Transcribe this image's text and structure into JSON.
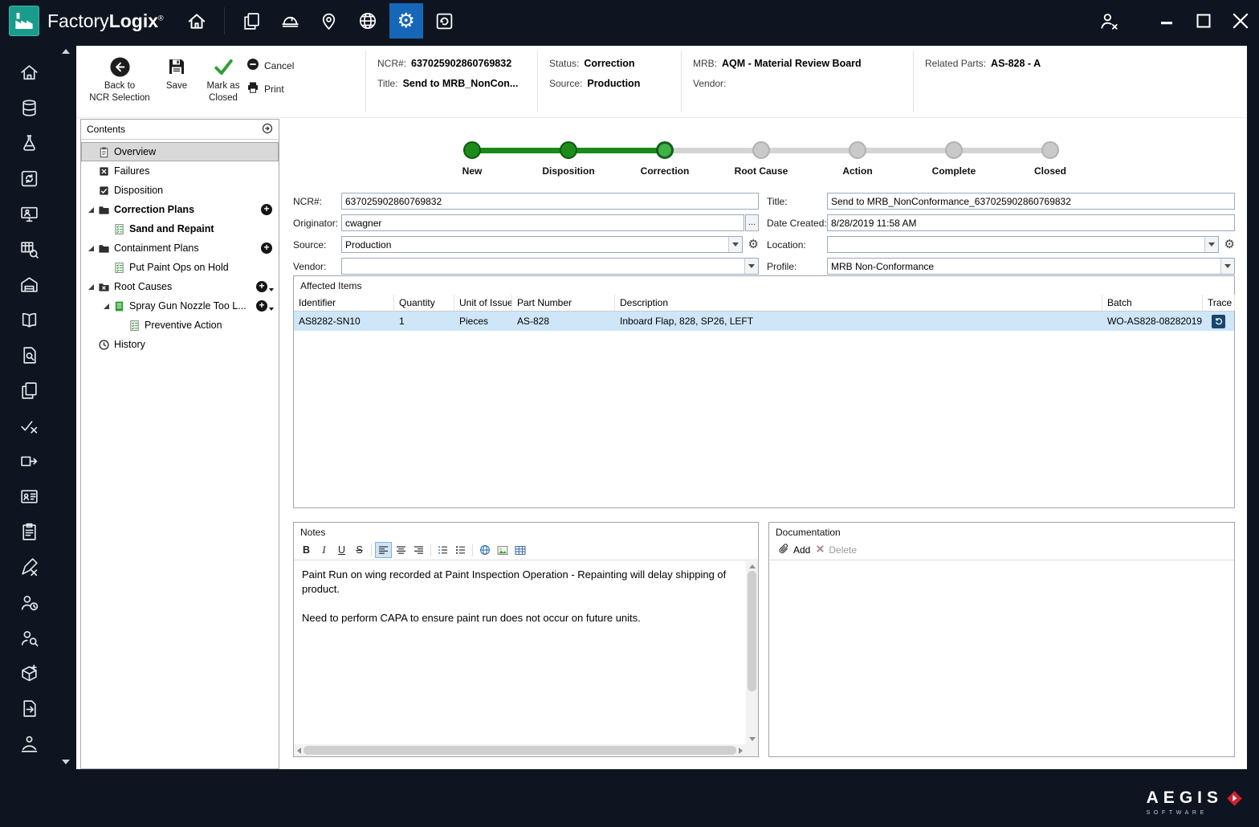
{
  "colors": {
    "chrome": "#0e1520",
    "accent_blue": "#1767b8",
    "brand_teal": "#1a9c8c",
    "step_done_green": "#188a18",
    "step_current_green": "#41b246",
    "row_selected_blue": "#cfe6f8",
    "aegis_red": "#cf2030"
  },
  "titlebar": {
    "brand_part1": "Factory",
    "brand_part2": "Logix",
    "registered_mark": "®",
    "icons": [
      "home",
      "copy-documents",
      "construction-helmet",
      "location-pin",
      "globe",
      "settings-gear",
      "history-refresh"
    ],
    "active_icon": "settings-gear",
    "window_icons": [
      "user-logout",
      "minimize",
      "maximize",
      "close"
    ]
  },
  "left_rail": {
    "icons": [
      "home",
      "production-data",
      "quality-check",
      "process-sync",
      "workstation",
      "schedule-search",
      "warehouse",
      "documentation-book",
      "document-search",
      "copy-pages",
      "verify-tasks",
      "material-transfer",
      "id-card",
      "work-instructions",
      "design-edit",
      "user-time",
      "user-search",
      "package-add",
      "document-export",
      "operator-handover",
      "data-grid"
    ]
  },
  "action_bar": {
    "back_label_line1": "Back to",
    "back_label_line2": "NCR Selection",
    "save_label": "Save",
    "mark_closed_line1": "Mark as",
    "mark_closed_line2": "Closed",
    "cancel_label": "Cancel",
    "print_label": "Print"
  },
  "summary": {
    "ncr_label": "NCR#:",
    "ncr_value": "637025902860769832",
    "title_label": "Title:",
    "title_value": "Send to MRB_NonCon...",
    "status_label": "Status:",
    "status_value": "Correction",
    "source_label": "Source:",
    "source_value": "Production",
    "mrb_label": "MRB:",
    "mrb_value": "AQM - Material Review Board",
    "vendor_label": "Vendor:",
    "vendor_value": "",
    "related_label": "Related Parts:",
    "related_value": "AS-828 - A"
  },
  "contents": {
    "header": "Contents",
    "items": [
      {
        "label": "Overview",
        "icon": "clipboard",
        "level": 0,
        "selected": true
      },
      {
        "label": "Failures",
        "icon": "failure-box",
        "level": 0
      },
      {
        "label": "Disposition",
        "icon": "check-box",
        "level": 0
      },
      {
        "label": "Correction Plans",
        "icon": "folder",
        "level": 0,
        "bold": true,
        "expander": true,
        "add": true
      },
      {
        "label": "Sand and Repaint",
        "icon": "plan-checklist",
        "level": 1,
        "bold": true
      },
      {
        "label": "Containment Plans",
        "icon": "folder",
        "level": 0,
        "expander": true,
        "add": true
      },
      {
        "label": "Put Paint Ops on Hold",
        "icon": "plan-checklist",
        "level": 1
      },
      {
        "label": "Root Causes",
        "icon": "folder-x",
        "level": 0,
        "expander": true,
        "add": true,
        "add_menu": true
      },
      {
        "label": "Spray Gun Nozzle Too L...",
        "icon": "cause-doc",
        "level": 1,
        "expander": true,
        "add": true,
        "add_menu": true
      },
      {
        "label": "Preventive Action",
        "icon": "plan-checklist",
        "level": 2
      },
      {
        "label": "History",
        "icon": "history-clock",
        "level": 0
      }
    ]
  },
  "stepper": [
    {
      "label": "New",
      "state": "done"
    },
    {
      "label": "Disposition",
      "state": "done"
    },
    {
      "label": "Correction",
      "state": "current"
    },
    {
      "label": "Root Cause",
      "state": "pending"
    },
    {
      "label": "Action",
      "state": "pending"
    },
    {
      "label": "Complete",
      "state": "pending"
    },
    {
      "label": "Closed",
      "state": "pending"
    }
  ],
  "form": {
    "ncr_label": "NCR#:",
    "ncr_value": "637025902860769832",
    "title_label": "Title:",
    "title_value": "Send to MRB_NonConformance_637025902860769832",
    "originator_label": "Originator:",
    "originator_value": "cwagner",
    "browse_button": "…",
    "date_created_label": "Date Created:",
    "date_created_value": "8/28/2019 11:58 AM",
    "source_label": "Source:",
    "source_value": "Production",
    "location_label": "Location:",
    "location_value": "",
    "vendor_label": "Vendor:",
    "vendor_value": "",
    "profile_label": "Profile:",
    "profile_value": "MRB Non-Conformance"
  },
  "affected_items": {
    "title": "Affected Items",
    "columns": [
      "Identifier",
      "Quantity",
      "Unit of Issue",
      "Part Number",
      "Description",
      "Batch",
      "Trace"
    ],
    "rows": [
      {
        "cells": [
          "AS8282-SN10",
          "1",
          "Pieces",
          "AS-828",
          "Inboard Flap, 828, SP26, LEFT",
          "WO-AS828-08282019"
        ],
        "trace_icon": "trace-history",
        "selected": true
      }
    ]
  },
  "notes": {
    "title": "Notes",
    "toolbar": {
      "bold": "B",
      "italic": "I",
      "underline": "U",
      "strike": "S"
    },
    "toolbar_icons": [
      "align-left",
      "align-center",
      "align-right",
      "numbered-list",
      "bullet-list",
      "hyperlink-globe",
      "insert-image",
      "insert-table"
    ],
    "paragraphs": [
      "Paint Run on wing recorded at Paint Inspection Operation - Repainting will delay shipping of product.",
      "Need to perform CAPA to ensure paint run does not occur on future units."
    ]
  },
  "documentation": {
    "title": "Documentation",
    "add_label": "Add",
    "delete_label": "Delete"
  },
  "footer": {
    "brand": "AEGIS",
    "brand_sub": "SOFTWARE"
  }
}
